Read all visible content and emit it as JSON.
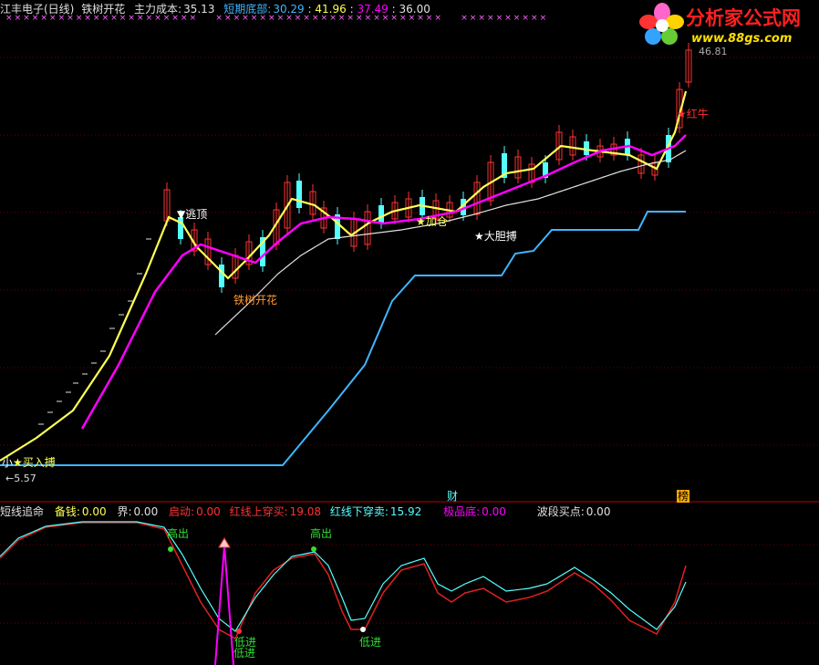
{
  "top_header": {
    "name": "江丰电子(日线)",
    "indicator": "铁树开花",
    "cost_label": "主力成本:",
    "cost_value": "35.13",
    "bottom_label": "短期底部:",
    "bottom_v1": "30.29",
    "sep": ":",
    "bottom_v2": "41.96",
    "bottom_v3": "37.49",
    "bottom_v4": "36.00"
  },
  "logo": {
    "title": "分析家公式网",
    "url": "www.88gs.com"
  },
  "price_labels": {
    "high": "46.81",
    "low": "5.57"
  },
  "main_annotations": {
    "escape_top": "▼逃顶",
    "tree_flower": "铁树开花",
    "add_position": "★加仓",
    "bold_bet": "★大胆搏",
    "red_bull": "★红牛",
    "small_bet": "小",
    "small_bet_star": "★",
    "buy_bet_overlap": "买入搏"
  },
  "markers": {
    "cai": "财",
    "bang": "榜"
  },
  "sub_header": {
    "title": "短线追命",
    "reserve_label": "备钱:",
    "reserve_value": "0.00",
    "jie_label": "界:",
    "jie_value": "0.00",
    "start_label": "启动:",
    "start_value": "0.00",
    "red_up_label": "红线上穿买:",
    "red_up_value": "19.08",
    "red_down_label": "红线下穿卖:",
    "red_down_value": "15.92",
    "extreme_label": "极品底:",
    "extreme_value": "0.00",
    "wave_label": "波段买点:",
    "wave_value": "0.00"
  },
  "sub_annotations": {
    "high_out_1": "高出",
    "high_out_2": "高出",
    "low_in_1": "低进",
    "low_in_2": "低进"
  },
  "colors": {
    "background": "#000000",
    "up_candle": "#ff3232",
    "down_candle": "#54ffff",
    "yellow_line": "#ffff54",
    "magenta_line": "#ff00ff",
    "white_line": "#e0e0e0",
    "blue_line": "#3fb6ff",
    "divider": "#c00000"
  }
}
